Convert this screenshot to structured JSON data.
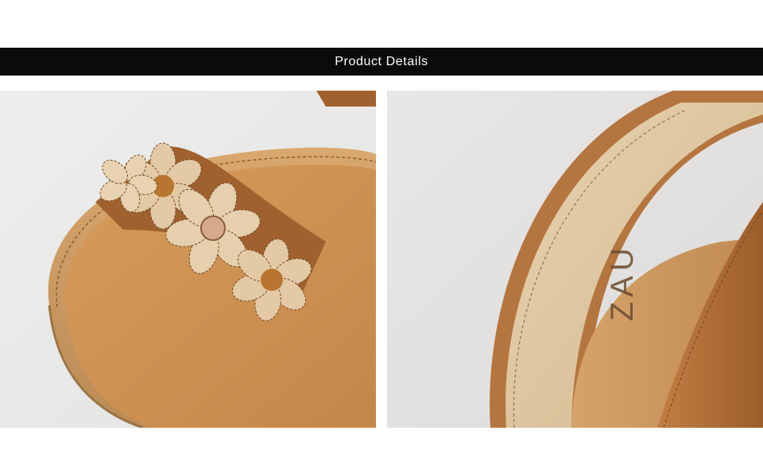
{
  "header": {
    "title": "Product Details",
    "background": "#0b0b0b",
    "text_color": "#ffffff"
  },
  "photos": [
    {
      "subject": "sandal-toe-strap-with-flowers",
      "colors": {
        "sole": "#c79a62",
        "strap": "#a0612f",
        "petal": "#e3c9a4",
        "flower_center": "#b7752f"
      }
    },
    {
      "subject": "sandal-heel-strap-closeup",
      "brand_mark": "ZAU",
      "colors": {
        "lining": "#dcc59f",
        "strap": "#b5753f",
        "insole": "#c8955e"
      }
    }
  ]
}
